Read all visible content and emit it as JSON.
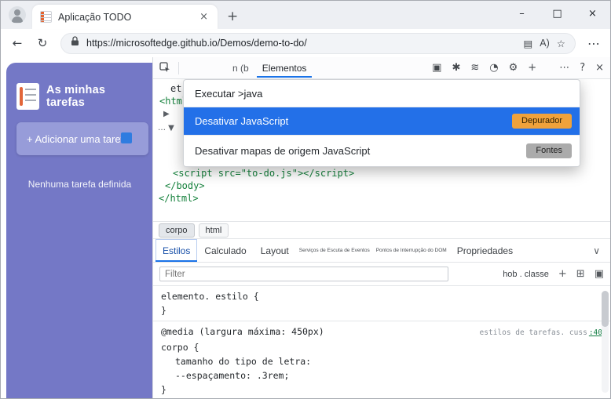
{
  "titlebar": {
    "tab": {
      "title": "Aplicação TODO",
      "close_icon": "×"
    },
    "new_tab_icon": "+",
    "window_controls": {
      "minimize": "–",
      "maximize": "□",
      "close": "×"
    }
  },
  "navbar": {
    "back_icon": "←",
    "refresh_icon": "↻",
    "url": "https://microsoftedge.github.io/Demos/demo-to-do/",
    "split_icon": "▤",
    "read_aloud_icon": "A)",
    "favorites_icon": "☆",
    "more_icon": "⋯"
  },
  "app": {
    "title": "As minhas tarefas",
    "add_task_button": "+ Adicionar uma tarefa",
    "empty_message": "Nenhuma tarefa definida"
  },
  "devtools": {
    "toolbar": {
      "partial_text": "n (b",
      "elements_tab": "Elementos",
      "icons": {
        "pip": "▣",
        "issues": "✱",
        "network": "≋",
        "performance": "◔",
        "settings": "⚙",
        "add": "+",
        "more": "⋯",
        "help": "?",
        "close": "×"
      }
    },
    "code": {
      "line1": "et",
      "line2": "<html",
      "line3": "▶",
      "line4": "… ▼",
      "line5": "<script src=\"to-do.js\"></script>",
      "line6": "</body>",
      "line7": "</html>"
    },
    "command_menu": {
      "query": "Executar >java",
      "items": [
        {
          "label": "Desativar JavaScript",
          "badge": "Depurador"
        },
        {
          "label": "Desativar mapas de origem JavaScript",
          "badge": "Fontes"
        }
      ]
    },
    "breadcrumb": {
      "item1": "corpo",
      "item2": "html"
    },
    "tabs": {
      "styles": "Estilos",
      "computed": "Calculado",
      "layout": "Layout",
      "event_listeners": "Serviços de Escuta de Eventos",
      "dom_breakpoints": "Pontos de Interrupção do DOM",
      "properties": "Propriedades",
      "chevron_icon": "∨"
    },
    "filter": {
      "placeholder": "Filter",
      "pseudo_classes": "hob . classe",
      "plus_icon": "+",
      "grid_icon": "⊞",
      "panel_icon": "▣"
    },
    "styles": {
      "rule1_selector": "elemento. estilo {",
      "rule1_close": "}",
      "rule2_media": "@media (largura máxima: 450px)",
      "rule2_source": "estilos de tarefas. cuss",
      "rule2_line": ":40",
      "rule2_selector": "corpo {",
      "rule2_prop1": "tamanho do tipo de letra:",
      "rule2_prop2": "--espaçamento: .3rem;",
      "rule2_close": "}"
    }
  },
  "colors": {
    "accent_blue": "#2370e8",
    "app_purple": "#7478c6",
    "badge_orange": "#f0a23b",
    "badge_gray": "#ababab",
    "code_green": "#15813c"
  }
}
